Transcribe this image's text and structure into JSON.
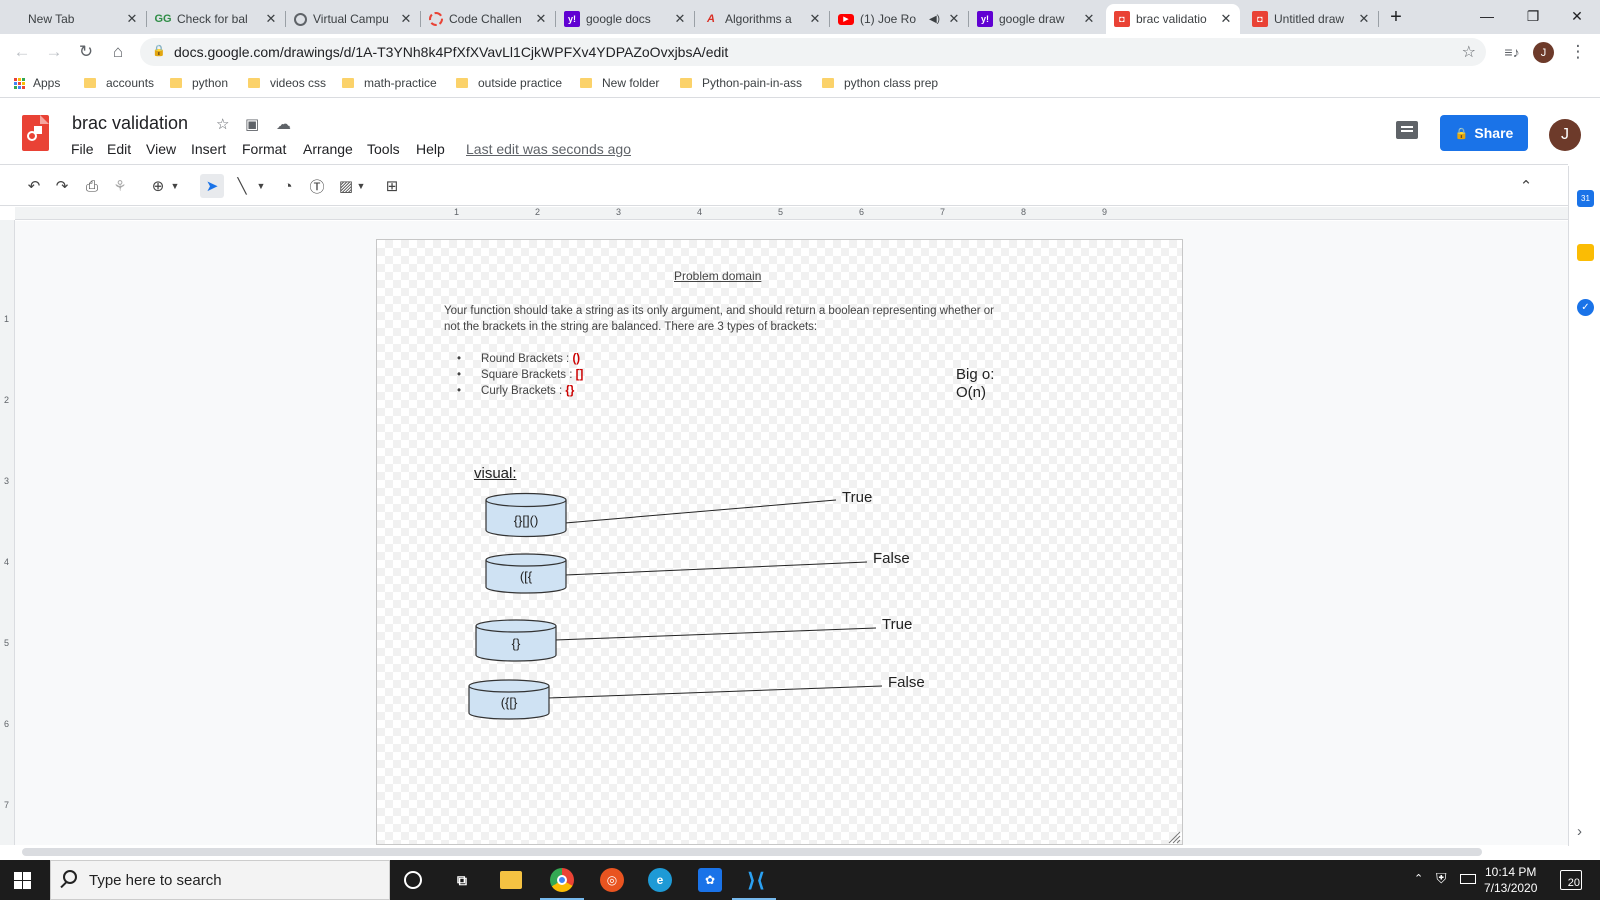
{
  "tabs": [
    {
      "title": "New Tab",
      "favicon": "none",
      "color": "#dee1e6"
    },
    {
      "title": "Check for bal",
      "favicon": "gg-icon",
      "color": "#2f8d46"
    },
    {
      "title": "Virtual Campu",
      "favicon": "globe-icon",
      "color": "#5f6368"
    },
    {
      "title": "Code Challen",
      "favicon": "circle-icon",
      "color": "#e94235"
    },
    {
      "title": "google docs",
      "favicon": "yahoo-icon",
      "color": "#6001d2"
    },
    {
      "title": "Algorithms a",
      "favicon": "algo-icon",
      "color": "#d93025"
    },
    {
      "title": "(1) Joe Ro",
      "favicon": "youtube-icon",
      "color": "#ff0000"
    },
    {
      "title": "google draw",
      "favicon": "yahoo-icon",
      "color": "#6001d2"
    },
    {
      "title": "brac validatio",
      "favicon": "drawings-icon",
      "color": "#e94235"
    },
    {
      "title": "Untitled draw",
      "favicon": "drawings-icon",
      "color": "#e94235"
    }
  ],
  "browser": {
    "url": "docs.google.com/drawings/d/1A-T3YNh8k4PfXfXVavLl1CjkWPFXv4YDPAZoOvxjbsA/edit",
    "profile_initial": "J",
    "bookmarks": [
      "Apps",
      "accounts",
      "python",
      "videos css",
      "math-practice",
      "outside practice",
      "New folder",
      "Python-pain-in-ass",
      "python class prep"
    ]
  },
  "doc": {
    "title": "brac validation",
    "menus": [
      "File",
      "Edit",
      "View",
      "Insert",
      "Format",
      "Arrange",
      "Tools",
      "Help"
    ],
    "last_edit": "Last edit was seconds ago",
    "share_label": "Share",
    "avatar_initial": "J"
  },
  "ruler": {
    "h": [
      "1",
      "2",
      "3",
      "4",
      "5",
      "6",
      "7",
      "8",
      "9"
    ],
    "v": [
      "1",
      "2",
      "3",
      "4",
      "5",
      "6",
      "7"
    ]
  },
  "drawing": {
    "heading": "Problem domain",
    "description": "Your function should take a string as its only argument, and should return a boolean representing whether or not the brackets in the string are balanced. There are 3 types of brackets:",
    "bullets": [
      {
        "label": "Round Brackets : ",
        "symbol": "()"
      },
      {
        "label": "Square Brackets : ",
        "symbol": "[]"
      },
      {
        "label": "Curly Brackets : ",
        "symbol": "{}"
      }
    ],
    "bigo_label": "Big o:",
    "bigo_value": "O(n)",
    "visual_label": "visual:",
    "examples": [
      {
        "input": "{}[]()",
        "result": "True"
      },
      {
        "input": "([{",
        "result": "False"
      },
      {
        "input": "{}",
        "result": "True"
      },
      {
        "input": "({[}",
        "result": "False"
      }
    ],
    "symbol_color": "#cc0000",
    "cylinder_fill": "#cfe2f3"
  },
  "taskbar": {
    "search_placeholder": "Type here to search",
    "time": "10:14 PM",
    "date": "7/13/2020",
    "notification_count": "20"
  },
  "colors": {
    "accent": "#1a73e8",
    "drawings_red": "#e94235"
  }
}
